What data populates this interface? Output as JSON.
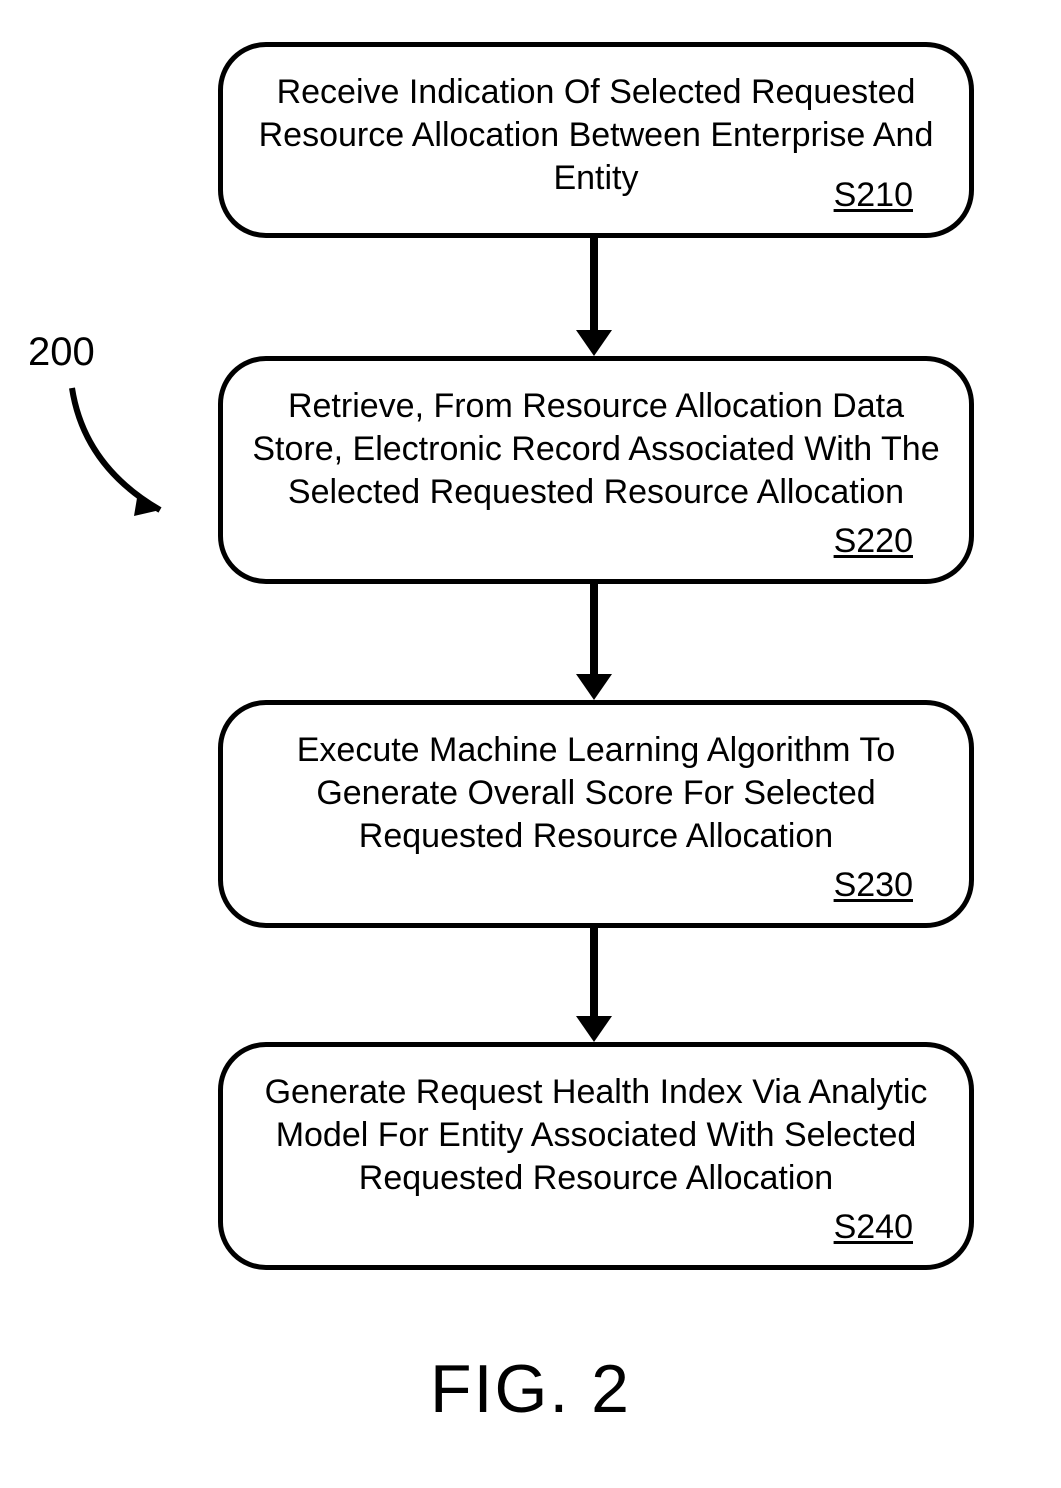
{
  "ref_label": "200",
  "caption": "FIG. 2",
  "steps": [
    {
      "text": "Receive Indication Of Selected Requested Resource Allocation Between Enterprise And Entity",
      "ref": "S210"
    },
    {
      "text": "Retrieve, From Resource Allocation Data Store, Electronic Record Associated With The Selected Requested Resource Allocation",
      "ref": "S220"
    },
    {
      "text": "Execute Machine Learning Algorithm To Generate Overall Score For Selected Requested Resource Allocation",
      "ref": "S230"
    },
    {
      "text": "Generate Request Health Index Via Analytic Model For Entity Associated With Selected Requested Resource Allocation",
      "ref": "S240"
    }
  ]
}
